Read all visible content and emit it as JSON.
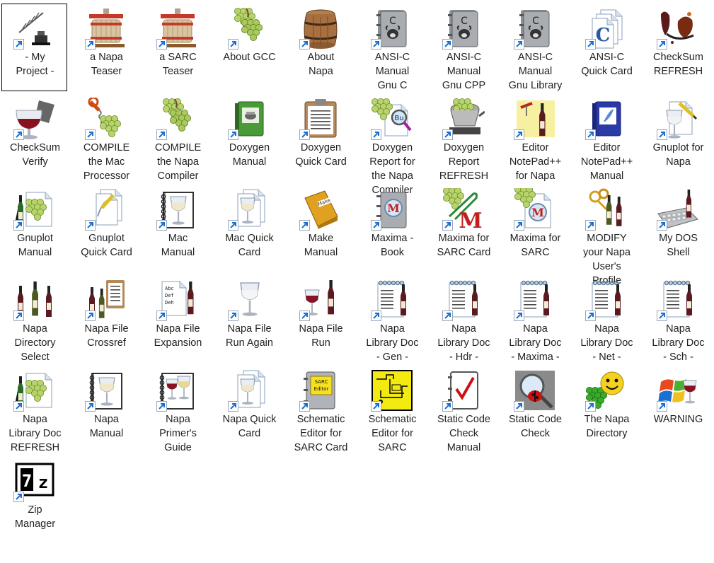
{
  "desktop": {
    "items": [
      {
        "label": "- My\nProject -",
        "icon": "project-folder-icon",
        "selected": true
      },
      {
        "label": "a Napa\nTeaser",
        "icon": "wine-press-icon"
      },
      {
        "label": "a SARC\nTeaser",
        "icon": "wine-press-icon"
      },
      {
        "label": "About GCC",
        "icon": "grapes-icon"
      },
      {
        "label": "About\nNapa",
        "icon": "barrel-icon"
      },
      {
        "label": "ANSI-C\nManual\nGnu C",
        "icon": "gnu-c-manual-icon"
      },
      {
        "label": "ANSI-C\nManual\nGnu CPP",
        "icon": "gnu-c-manual-icon"
      },
      {
        "label": "ANSI-C\nManual\nGnu Library",
        "icon": "gnu-c-manual-icon"
      },
      {
        "label": "ANSI-C\nQuick Card",
        "icon": "c-quick-card-icon"
      },
      {
        "label": "CheckSum\nREFRESH",
        "icon": "wine-splash-icon"
      },
      {
        "label": "CheckSum\nVerify",
        "icon": "wine-glass-icon"
      },
      {
        "label": "COMPILE\nthe Mac\nProcessor",
        "icon": "corkscrew-grapes-icon"
      },
      {
        "label": "COMPILE\nthe Napa\nCompiler",
        "icon": "grapes-icon"
      },
      {
        "label": "Doxygen\nManual",
        "icon": "green-book-icon"
      },
      {
        "label": "Doxygen\nQuick Card",
        "icon": "clipboard-icon"
      },
      {
        "label": "Doxygen\nReport for\nthe Napa\nCompiler",
        "icon": "magnifier-grapes-icon"
      },
      {
        "label": "Doxygen\nReport\nREFRESH",
        "icon": "grinder-icon"
      },
      {
        "label": "Editor\nNotePad++\nfor Napa",
        "icon": "corkscrew-bottle-icon"
      },
      {
        "label": "Editor\nNotePad++\nManual",
        "icon": "blue-book-icon"
      },
      {
        "label": "Gnuplot for\nNapa",
        "icon": "glass-pencil-icon"
      },
      {
        "label": "Gnuplot\nManual",
        "icon": "grapes-document-icon"
      },
      {
        "label": "Gnuplot\nQuick Card",
        "icon": "document-pencil-icon"
      },
      {
        "label": "Mac\nManual",
        "icon": "notebook-glass-icon"
      },
      {
        "label": "Mac Quick\nCard",
        "icon": "document-glass-icon"
      },
      {
        "label": "Make\nManual",
        "icon": "make-book-icon"
      },
      {
        "label": "Maxima -\nBook",
        "icon": "maxima-book-icon"
      },
      {
        "label": "Maxima for\nSARC Card",
        "icon": "maxima-clip-icon"
      },
      {
        "label": "Maxima for\nSARC",
        "icon": "maxima-document-icon"
      },
      {
        "label": "MODIFY\nyour Napa\nUser's\nProfile",
        "icon": "keys-bottles-icon"
      },
      {
        "label": "My DOS\nShell",
        "icon": "keyboard-bottle-icon"
      },
      {
        "label": "Napa\nDirectory\nSelect",
        "icon": "three-bottles-icon"
      },
      {
        "label": "Napa File\nCrossref",
        "icon": "bottles-clipboard-icon"
      },
      {
        "label": "Napa File\nExpansion",
        "icon": "document-bottle-icon"
      },
      {
        "label": "Napa File\nRun Again",
        "icon": "empty-glass-icon"
      },
      {
        "label": "Napa File\nRun",
        "icon": "glass-bottle-icon"
      },
      {
        "label": "Napa\nLibrary Doc\n- Gen -",
        "icon": "notepad-bottle-icon"
      },
      {
        "label": "Napa\nLibrary Doc\n- Hdr -",
        "icon": "notepad-bottle-icon"
      },
      {
        "label": "Napa\nLibrary Doc\n- Maxima -",
        "icon": "notepad-bottle-icon"
      },
      {
        "label": "Napa\nLibrary Doc\n- Net -",
        "icon": "notepad-bottle-icon"
      },
      {
        "label": "Napa\nLibrary Doc\n- Sch -",
        "icon": "notepad-bottle-icon"
      },
      {
        "label": "Napa\nLibrary Doc\nREFRESH",
        "icon": "grapes-document-icon"
      },
      {
        "label": "Napa\nManual",
        "icon": "notebook-glass-icon"
      },
      {
        "label": "Napa\nPrimer's\nGuide",
        "icon": "notebook-glasses-icon"
      },
      {
        "label": "Napa Quick\nCard",
        "icon": "document-glass-icon"
      },
      {
        "label": "Schematic\nEditor for\nSARC Card",
        "icon": "sarc-editor-book-icon"
      },
      {
        "label": "Schematic\nEditor for\nSARC",
        "icon": "schematic-note-icon"
      },
      {
        "label": "Static Code\nCheck\nManual",
        "icon": "checkmark-book-icon"
      },
      {
        "label": "Static Code\nCheck",
        "icon": "ladybug-magnifier-icon"
      },
      {
        "label": "The Napa\nDirectory",
        "icon": "smiley-grapes-icon"
      },
      {
        "label": "WARNING",
        "icon": "windows-glass-icon"
      },
      {
        "label": "Zip\nManager",
        "icon": "zip-archive-icon"
      }
    ]
  }
}
